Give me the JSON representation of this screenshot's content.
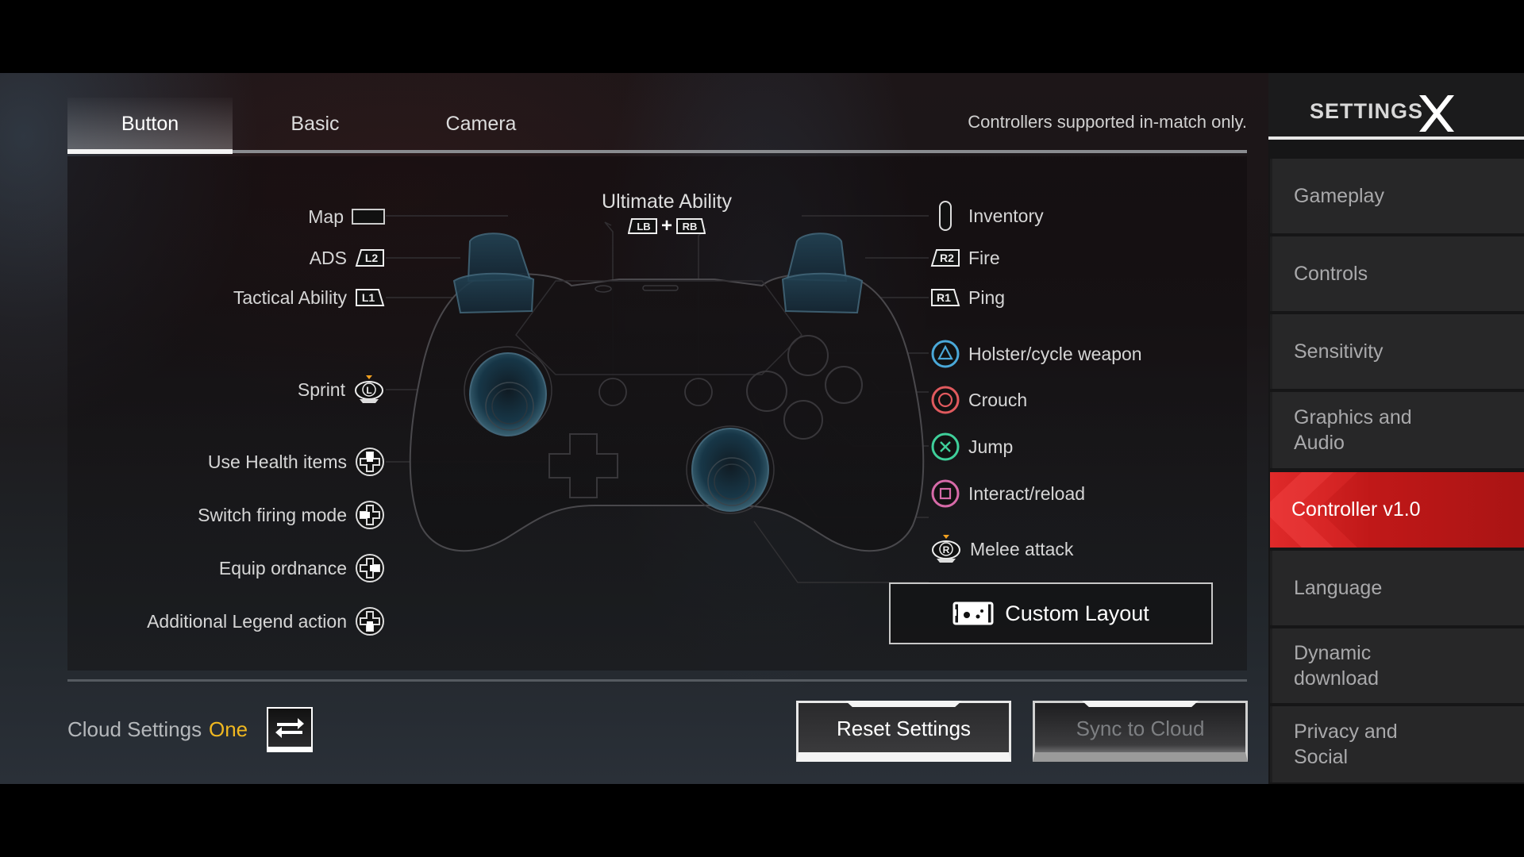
{
  "tabs": {
    "items": [
      {
        "label": "Button",
        "active": true
      },
      {
        "label": "Basic",
        "active": false
      },
      {
        "label": "Camera",
        "active": false
      }
    ],
    "note": "Controllers supported in-match only."
  },
  "controller": {
    "ultimate": {
      "label": "Ultimate Ability",
      "keys": [
        "LB",
        "RB"
      ],
      "plus": "+"
    },
    "left_mappings": [
      {
        "label": "Map",
        "icon": "touchpad-icon"
      },
      {
        "label": "ADS",
        "icon": "l2-trigger-icon",
        "key": "L2"
      },
      {
        "label": "Tactical Ability",
        "icon": "l1-bumper-icon",
        "key": "L1"
      },
      {
        "label": "Sprint",
        "icon": "left-stick-press-icon",
        "key": "L"
      },
      {
        "label": "Use Health items",
        "icon": "dpad-up-icon"
      },
      {
        "label": "Switch firing mode",
        "icon": "dpad-left-icon"
      },
      {
        "label": "Equip ordnance",
        "icon": "dpad-right-icon"
      },
      {
        "label": "Additional Legend action",
        "icon": "dpad-down-icon"
      }
    ],
    "right_mappings": [
      {
        "label": "Inventory",
        "icon": "options-button-icon"
      },
      {
        "label": "Fire",
        "icon": "r2-trigger-icon",
        "key": "R2"
      },
      {
        "label": "Ping",
        "icon": "r1-bumper-icon",
        "key": "R1"
      },
      {
        "label": "Holster/cycle weapon",
        "icon": "triangle-button-icon",
        "color": "#4aa8d8"
      },
      {
        "label": "Crouch",
        "icon": "circle-button-icon",
        "color": "#e05a5e"
      },
      {
        "label": "Jump",
        "icon": "cross-button-icon",
        "color": "#3fcf9a"
      },
      {
        "label": "Interact/reload",
        "icon": "square-button-icon",
        "color": "#d66aa8"
      },
      {
        "label": "Melee attack",
        "icon": "right-stick-press-icon",
        "key": "R"
      }
    ],
    "custom_layout_label": "Custom Layout"
  },
  "cloud": {
    "label": "Cloud Settings",
    "value": "One",
    "value_color": "#f0b820"
  },
  "buttons": {
    "reset": "Reset Settings",
    "sync": "Sync to Cloud"
  },
  "sidebar": {
    "title": "SETTINGS",
    "items": [
      {
        "label": "Gameplay",
        "active": false
      },
      {
        "label": "Controls",
        "active": false
      },
      {
        "label": "Sensitivity",
        "active": false
      },
      {
        "label": "Graphics and Audio",
        "active": false
      },
      {
        "label": "Controller v1.0",
        "active": true
      },
      {
        "label": "Language",
        "active": false
      },
      {
        "label": "Dynamic download",
        "active": false
      },
      {
        "label": "Privacy and Social",
        "active": false
      }
    ],
    "accent_color": "#c41a1a"
  }
}
